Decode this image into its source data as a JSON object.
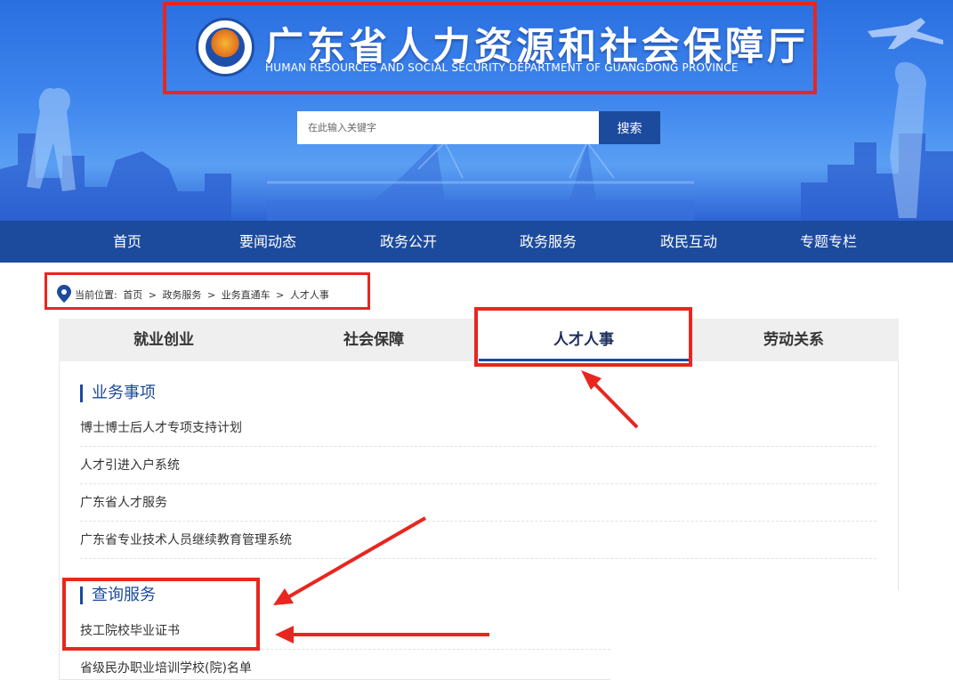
{
  "header": {
    "title": "广东省人力资源和社会保障厅",
    "subtitle": "HUMAN RESOURCES AND SOCIAL SECURITY DEPARTMENT OF GUANGDONG PROVINCE",
    "emblem_icon": "department-emblem-icon"
  },
  "search": {
    "placeholder": "在此输入关键字",
    "button_label": "搜索"
  },
  "nav": {
    "items": [
      "首页",
      "要闻动态",
      "政务公开",
      "政务服务",
      "政民互动",
      "专题专栏"
    ]
  },
  "breadcrumb": {
    "prefix": "当前位置:",
    "items": [
      "首页",
      ">",
      "政务服务",
      ">",
      "业务直通车",
      ">",
      "人才人事"
    ]
  },
  "tabs": {
    "items": [
      "就业创业",
      "社会保障",
      "人才人事",
      "劳动关系"
    ],
    "active": "人才人事"
  },
  "sections": [
    {
      "title": "业务事项",
      "items": [
        "博士博士后人才专项支持计划",
        "人才引进入户系统",
        "广东省人才服务",
        "广东省专业技术人员继续教育管理系统"
      ]
    },
    {
      "title": "查询服务",
      "items": [
        "技工院校毕业证书",
        "省级民办职业培训学校(院)名单"
      ]
    }
  ],
  "colors": {
    "nav_bg": "#1c4a9c",
    "annotation_red": "#e8261f",
    "banner_blue": "#3f86ee"
  }
}
